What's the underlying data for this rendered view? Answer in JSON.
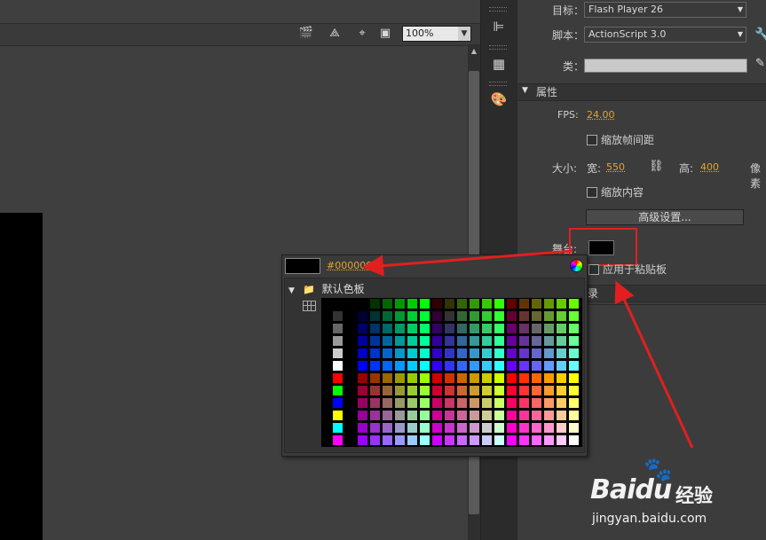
{
  "stage": {
    "zoom_value": "100%"
  },
  "properties": {
    "target_label": "目标：",
    "target_value": "Flash Player 26",
    "script_label": "脚本：",
    "script_value": "ActionScript 3.0",
    "class_label": "类：",
    "class_value": "",
    "section_properties": "属性",
    "fps_label": "FPS:",
    "fps_value": "24.00",
    "scale_spans_label": "缩放帧间距",
    "size_label": "大小:",
    "width_label": "宽:",
    "width_value": "550",
    "height_label": "高:",
    "height_value": "400",
    "pixels_label": "像素",
    "scale_content_label": "缩放内容",
    "advanced_button": "高级设置...",
    "stage_label": "舞台:",
    "apply_clipboard_label": "应用于粘贴板",
    "section_history_partial": "录"
  },
  "color_popup": {
    "hex_value": "#000000",
    "palette_title": "默认色板"
  },
  "watermark": {
    "logo": "Baidu",
    "suffix": "经验",
    "url": "jingyan.baidu.com"
  },
  "colors": {
    "accent_orange": "#e5a231",
    "annotation_red": "#e21f1f",
    "stage_color": "#000000"
  }
}
